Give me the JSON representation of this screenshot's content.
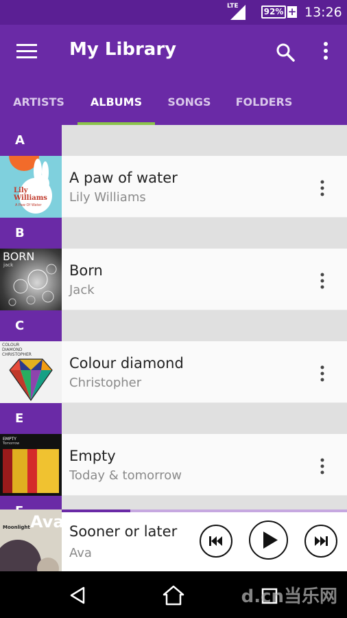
{
  "status_bar": {
    "network": "LTE",
    "battery": "92%",
    "charging": "+",
    "time": "13:26"
  },
  "app_bar": {
    "title": "My Library",
    "tabs": [
      {
        "label": "ARTISTS",
        "active": false
      },
      {
        "label": "ALBUMS",
        "active": true
      },
      {
        "label": "SONGS",
        "active": false
      },
      {
        "label": "FOLDERS",
        "active": false
      }
    ]
  },
  "sections": [
    {
      "letter": "A",
      "albums": [
        {
          "title": "A paw of water",
          "artist": "Lily Williams",
          "cover_text": [
            "Lily",
            "Williams",
            "A Paw Of Water"
          ]
        }
      ]
    },
    {
      "letter": "B",
      "albums": [
        {
          "title": "Born",
          "artist": "Jack",
          "cover_text": [
            "BORN",
            "jack"
          ]
        }
      ]
    },
    {
      "letter": "C",
      "albums": [
        {
          "title": "Colour diamond",
          "artist": "Christopher",
          "cover_text": [
            "COLOUR",
            "DIAMOND",
            "CHRISTOPHER"
          ]
        }
      ]
    },
    {
      "letter": "E",
      "albums": [
        {
          "title": "Empty",
          "artist": "Today & tomorrow",
          "cover_text": [
            "EMPTY",
            "Tomorrow"
          ]
        }
      ]
    },
    {
      "letter": "F",
      "albums": []
    }
  ],
  "now_playing": {
    "title": "Sooner or later",
    "artist": "Ava",
    "cover_text": [
      "Moonlight",
      "Ava"
    ],
    "progress": 0.24
  },
  "watermark": "d.cn当乐网",
  "colors": {
    "primary": "#6a2aa6",
    "status": "#5b1f94",
    "accent": "#8bc34a"
  }
}
